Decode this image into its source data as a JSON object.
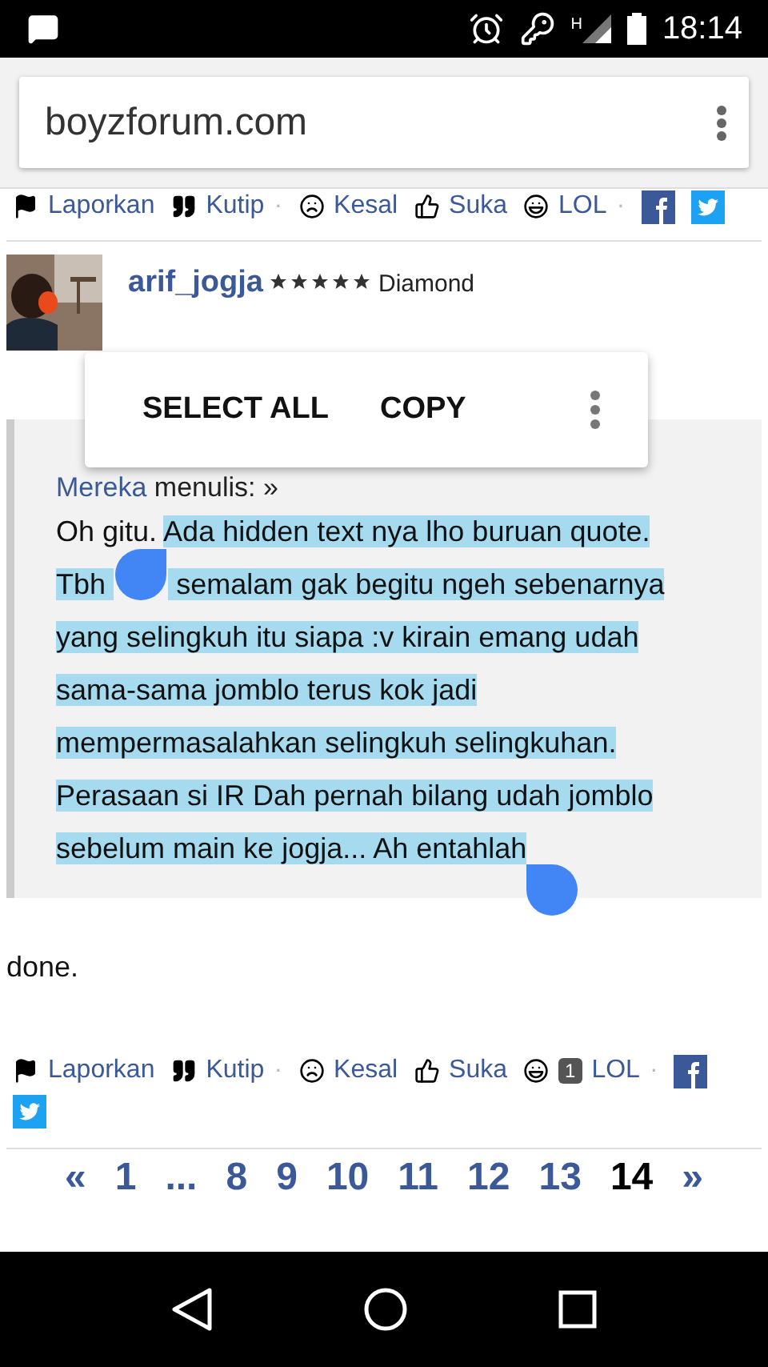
{
  "status_bar": {
    "time": "18:14",
    "network": "H"
  },
  "address_bar": {
    "url": "boyzforum.com"
  },
  "post_actions_top": [
    {
      "kind": "report",
      "label": "Laporkan"
    },
    {
      "kind": "quote",
      "label": "Kutip",
      "separator": "·"
    },
    {
      "kind": "annoyed",
      "label": "Kesal"
    },
    {
      "kind": "like",
      "label": "Suka"
    },
    {
      "kind": "lol",
      "label": "LOL",
      "separator": "·"
    }
  ],
  "post": {
    "author": "arif_jogja",
    "stars": 5,
    "rank": "Diamond",
    "quote": {
      "source": "Mereka",
      "said": "menulis: »"
    },
    "text_before": "Oh gitu. ",
    "selected_text": [
      "Ada hidden text nya lho buruan quote. Tbh",
      "semalam gak begitu ngeh sebenarnya yang selingkuh itu siapa :v kirain emang udah sama-sama jomblo terus kok jadi mempermasalahkan selingkuh selingkuhan. Perasaan si IR Dah pernah bilang udah jomblo sebelum main ke jogja... Ah entahlah"
    ]
  },
  "selection_menu": {
    "items": [
      "SELECT ALL",
      "COPY"
    ]
  },
  "reply": {
    "text": "done."
  },
  "post_actions_bottom": [
    {
      "kind": "report",
      "label": "Laporkan"
    },
    {
      "kind": "quote",
      "label": "Kutip",
      "separator": "·"
    },
    {
      "kind": "annoyed",
      "label": "Kesal"
    },
    {
      "kind": "like",
      "label": "Suka"
    },
    {
      "kind": "lol",
      "label": "LOL",
      "count": "1",
      "separator": "·"
    }
  ],
  "pagination": [
    {
      "label": "«",
      "selected": false
    },
    {
      "label": "1",
      "selected": false
    },
    {
      "label": "...",
      "selected": false
    },
    {
      "label": "8",
      "selected": false
    },
    {
      "label": "9",
      "selected": false
    },
    {
      "label": "10",
      "selected": false
    },
    {
      "label": "11",
      "selected": false
    },
    {
      "label": "12",
      "selected": false
    },
    {
      "label": "13",
      "selected": false
    },
    {
      "label": "14",
      "selected": true
    },
    {
      "label": "»",
      "selected": false
    }
  ]
}
